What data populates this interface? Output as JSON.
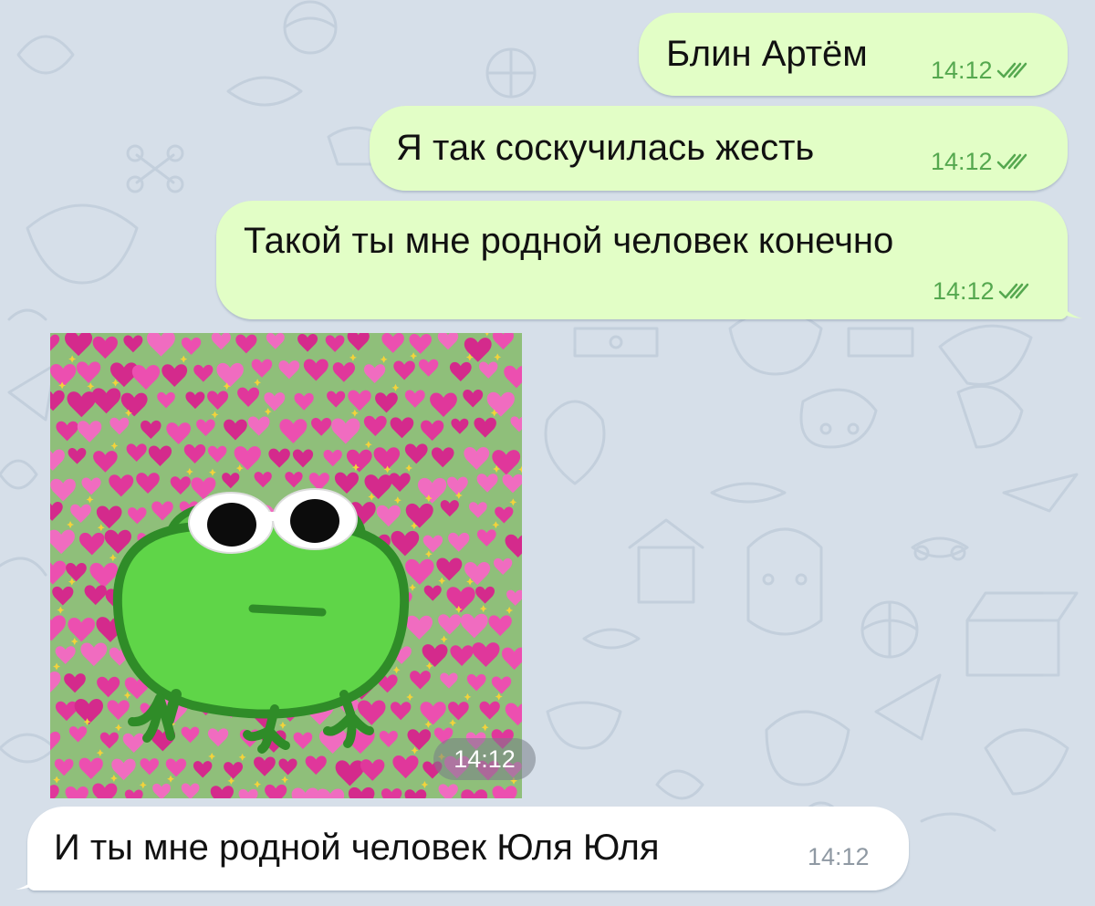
{
  "chat": {
    "messages": [
      {
        "text": "Блин Артём",
        "time": "14:12",
        "direction": "outgoing",
        "read": true
      },
      {
        "text": "Я так соскучилась жесть",
        "time": "14:12",
        "direction": "outgoing",
        "read": true
      },
      {
        "text": "Такой ты мне родной человек конечно",
        "time": "14:12",
        "direction": "outgoing",
        "read": true
      },
      {
        "text": "",
        "time": "14:12",
        "direction": "incoming",
        "type": "photo",
        "photo_icon": "frog-sunglasses-hearts-meme"
      },
      {
        "text": "И ты мне родной человек Юля Юля",
        "time": "14:12",
        "direction": "incoming"
      }
    ],
    "read_receipt_icon": "double-check-icon"
  },
  "colors": {
    "background": "#d6dfe9",
    "outgoing_bubble": "#e2fec6",
    "incoming_bubble": "#ffffff",
    "outgoing_meta": "#55a84f",
    "incoming_meta": "#8f99a3",
    "frog_green": "#63d24a",
    "heart_pink": "#e0379b"
  }
}
